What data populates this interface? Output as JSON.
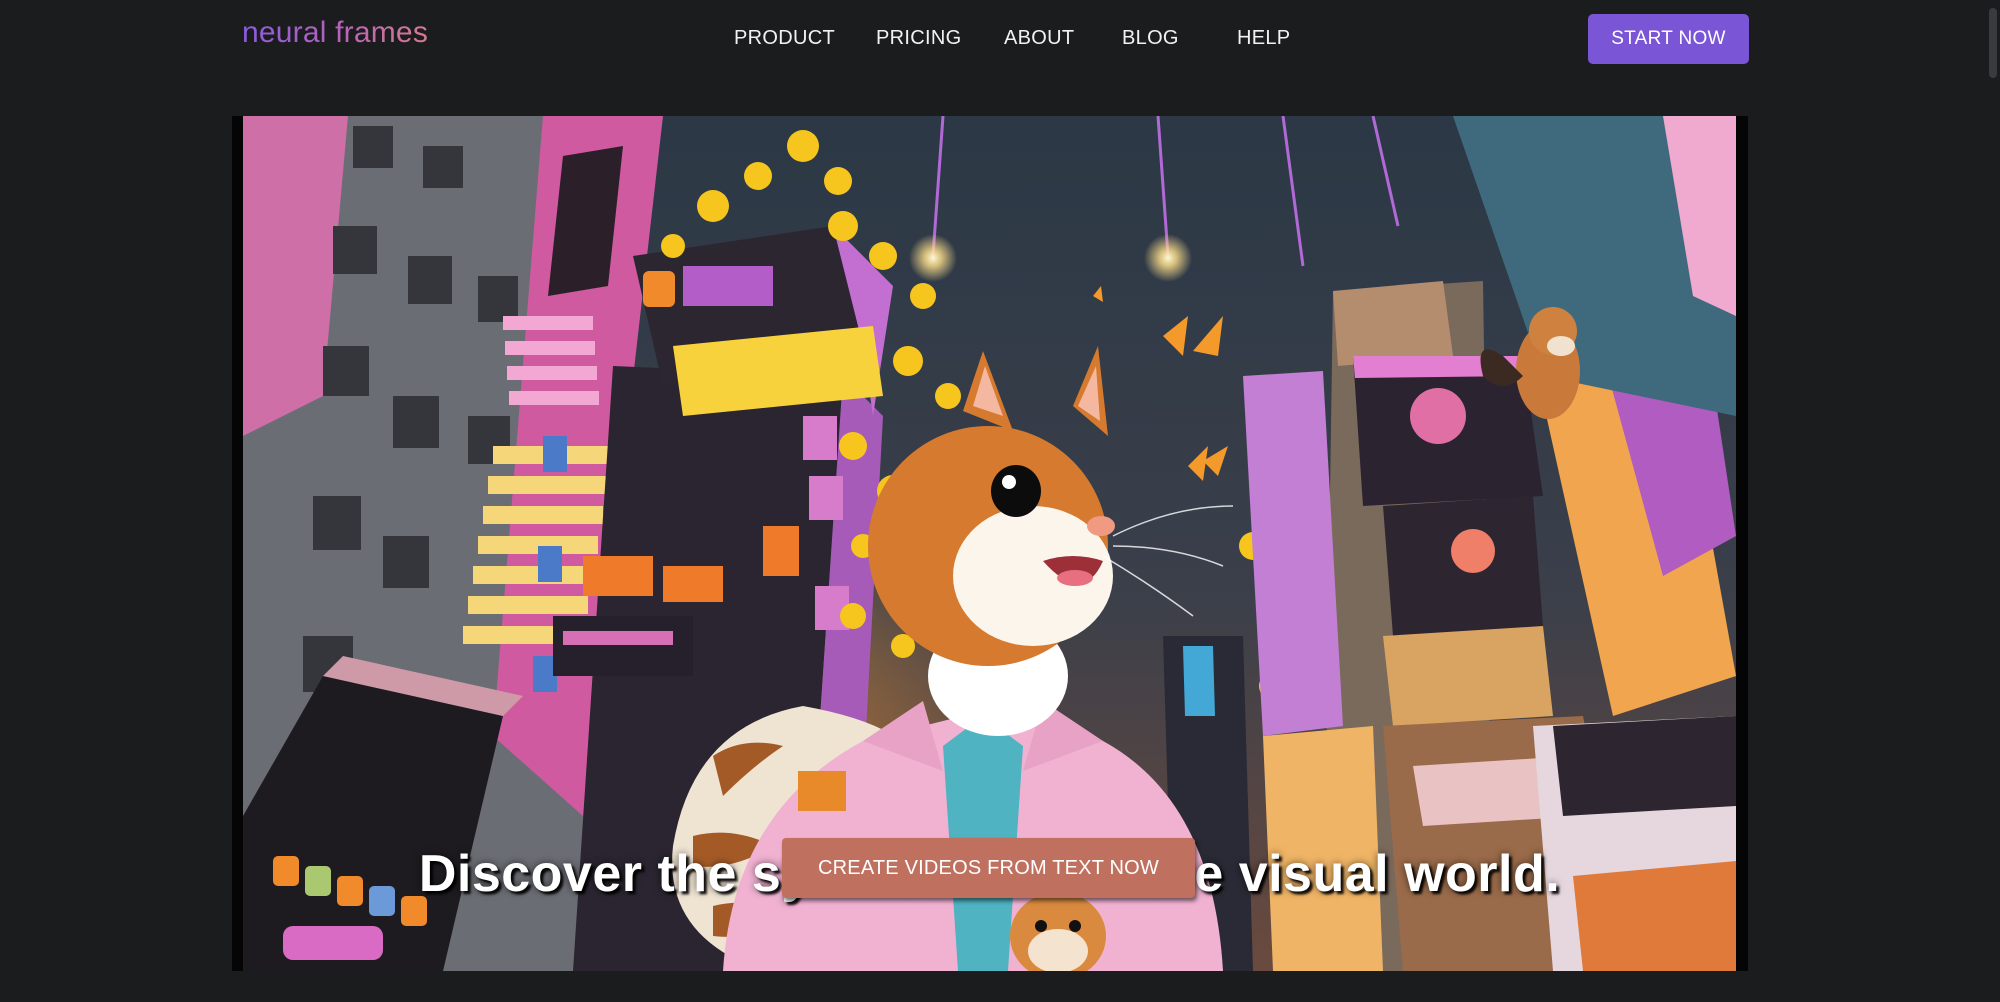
{
  "brand": {
    "name": "neural frames"
  },
  "nav": {
    "items": [
      {
        "label": "PRODUCT"
      },
      {
        "label": "PRICING"
      },
      {
        "label": "ABOUT"
      },
      {
        "label": "BLOG"
      },
      {
        "label": "HELP"
      }
    ],
    "cta_label": "START NOW"
  },
  "hero": {
    "headline": "Discover the synthesizer for the visual world.",
    "cta_label": "CREATE VIDEOS FROM TEXT NOW",
    "image_subject": "squirrel in pink jacket in neon city"
  },
  "colors": {
    "background": "#1b1c1e",
    "accent": "#7a55d6",
    "hero_cta": "#c0705f",
    "logo_gradient_start": "#8a5be0",
    "logo_gradient_end": "#d77a8e"
  },
  "icons": [
    "squirrel-illustration"
  ]
}
